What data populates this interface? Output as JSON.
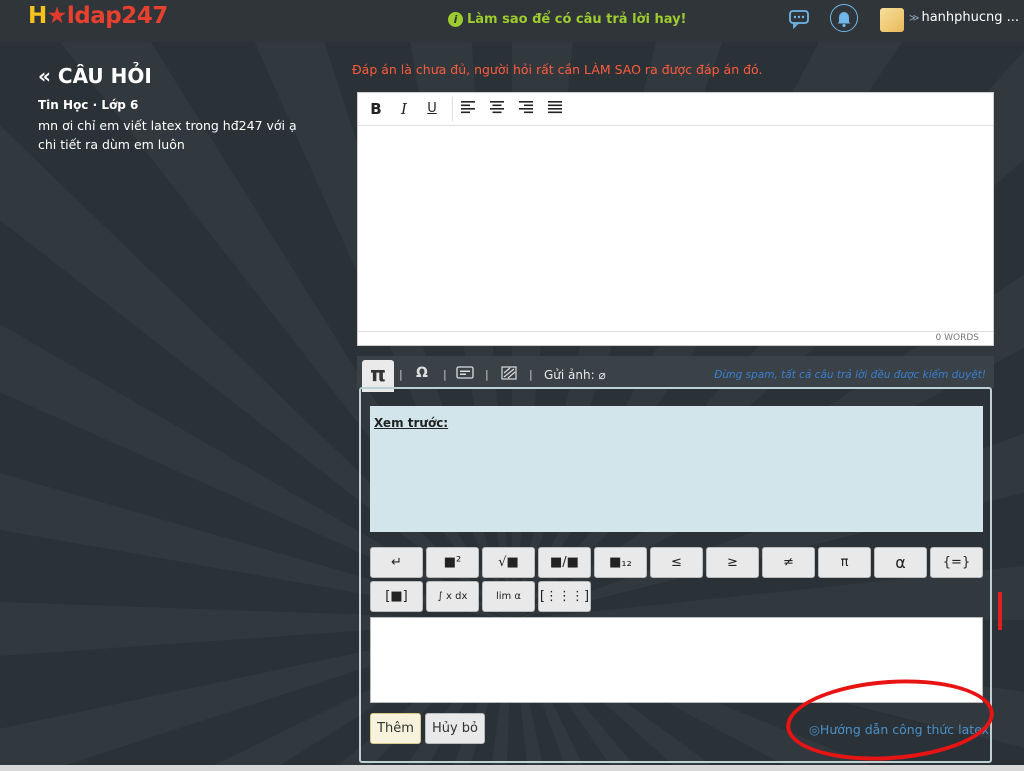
{
  "header": {
    "logo": {
      "h": "H",
      "star": "★",
      "rest": "ldap247"
    },
    "tip": "Làm sao để có câu trả lời hay!",
    "username": "hanhphucng ..."
  },
  "question": {
    "heading": "CÂU HỎI",
    "meta": "Tin Học · Lớp 6",
    "text": "mn ơi chỉ em viết latex trong hđ247 với ạ chi tiết ra dùm em luôn"
  },
  "answer": {
    "warning": "Đáp án là chưa đủ, người hỏi rất cần LÀM SAO ra được đáp án đó.",
    "toolbar": {
      "bold": "B",
      "italic": "I",
      "underline": "U"
    },
    "word_count": "0 WORDS"
  },
  "math": {
    "tab_symbol": "π",
    "send_image_label": "Gửi ảnh:",
    "spam_notice": "Đừng spam, tất cả câu trả lời đều được kiểm duyệt!",
    "preview_label": "Xem trước:",
    "buttons_row1": [
      "↵",
      "■²",
      "√■",
      "■/■",
      "■₁₂",
      "≤",
      "≥",
      "≠",
      "π",
      "α",
      "{=}"
    ],
    "buttons_row2": [
      "[■]",
      "∫ x dx",
      "lim α",
      "[⋮⋮⋮]"
    ],
    "add_label": "Thêm",
    "cancel_label": "Hủy bỏ",
    "help_link": "Hướng dẫn công thức latex"
  },
  "colors": {
    "accent": "#9ccc2e",
    "warning": "#ff5a3c",
    "link": "#4a90c8",
    "annotation": "#e81414"
  }
}
